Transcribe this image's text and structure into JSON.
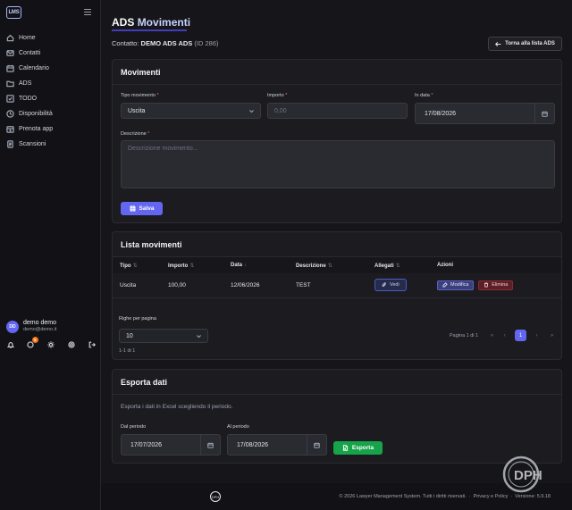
{
  "app": {
    "logo_text": "LMS"
  },
  "sidebar": {
    "items": [
      {
        "label": "Home",
        "icon": "home-icon"
      },
      {
        "label": "Contatti",
        "icon": "mail-icon"
      },
      {
        "label": "Calendario",
        "icon": "calendar-icon"
      },
      {
        "label": "ADS",
        "icon": "folder-icon"
      },
      {
        "label": "TODO",
        "icon": "checkbox-icon"
      },
      {
        "label": "Disponibilità",
        "icon": "clock-icon"
      },
      {
        "label": "Prenota app",
        "icon": "calendar-plus-icon"
      },
      {
        "label": "Scansioni",
        "icon": "scan-icon"
      }
    ],
    "user": {
      "initials": "DD",
      "name": "demo demo",
      "email": "demo@demo.it",
      "notification_count": "5"
    }
  },
  "header": {
    "title_part1": "ADS",
    "title_part2": "Movimenti",
    "contact_prefix": "Contatto:",
    "contact_name": "DEMO ADS ADS",
    "contact_id": "(ID 286)",
    "back_button": "Torna alla lista ADS"
  },
  "form": {
    "title": "Movimenti",
    "tipo_label": "Tipo movimento",
    "tipo_value": "Uscita",
    "importo_label": "Importo",
    "importo_placeholder": "0,00",
    "data_label": "In data",
    "data_value": "17/08/2026",
    "descrizione_label": "Descrizione",
    "descrizione_placeholder": "Descrizione movimento...",
    "required_mark": "*",
    "save_button": "Salva"
  },
  "list": {
    "title": "Lista movimenti",
    "columns": [
      "Tipo",
      "Importo",
      "Data",
      "Descrizione",
      "Allegati",
      "Azioni"
    ],
    "sort_neutral": "⇅",
    "sort_desc": "↓",
    "rows": [
      {
        "tipo": "Uscita",
        "importo": "100,00",
        "data": "12/06/2026",
        "descrizione": "TEST",
        "allegati": "Vedi",
        "edit": "Modifica",
        "delete": "Elimina"
      }
    ],
    "rows_per_page_label": "Righe per pagina",
    "rows_per_page_value": "10",
    "range_text": "1-1 di 1",
    "page_text": "Pagina 1 di 1",
    "pagination": {
      "first": "«",
      "prev": "‹",
      "current": "1",
      "next": "›",
      "last": "»"
    }
  },
  "export": {
    "title": "Esporta dati",
    "description": "Esporta i dati in Excel scegliendo il periodo.",
    "from_label": "Dal periodo",
    "from_value": "17/07/2026",
    "to_label": "Al periodo",
    "to_value": "17/08/2026",
    "button": "Esporta"
  },
  "footer": {
    "mark": "DPH",
    "copyright": "© 2026 Lawyer Management System. Tutti i diritti riservati.",
    "privacy": "Privacy e Policy",
    "version": "Versione: 5.9.18"
  },
  "watermark": {
    "text": "DPH"
  },
  "colors": {
    "accent": "#6366f1",
    "success": "#16a34a",
    "danger": "#8a2a36",
    "background": "#16161a"
  }
}
